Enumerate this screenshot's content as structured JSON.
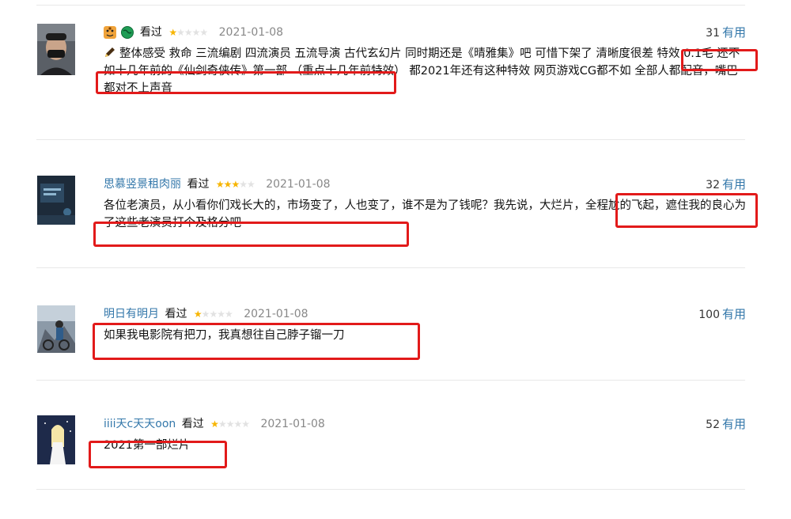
{
  "useful_label": "有用",
  "comments": [
    {
      "user": "",
      "status": "看过",
      "rating": 1,
      "date": "2021-01-08",
      "votes": "31",
      "icons": [
        "tiger-face-icon",
        "globe-icon"
      ],
      "body_icon": "pencil-icon",
      "text": "整体感受 救命 三流编剧 四流演员 五流导演 古代玄幻片 同时期还是《晴雅集》吧 可惜下架了 清晰度很差 特效 0.1毛 还不如十几年前的《仙剑奇侠传》第一部 （重点十几年前特效） 都2021年还有这种特效 网页游戏CG都不如 全部人都配音，嘴巴都对不上声音"
    },
    {
      "user": "思慕竖景租肉丽",
      "status": "看过",
      "rating": 3,
      "date": "2021-01-08",
      "votes": "32",
      "text": "各位老演员，从小看你们戏长大的，市场变了，人也变了，谁不是为了钱呢？我先说，大烂片，全程尬的飞起，遮住我的良心为了这些老演员打个及格分吧"
    },
    {
      "user": "明日有明月",
      "status": "看过",
      "rating": 1,
      "date": "2021-01-08",
      "votes": "100",
      "text": "如果我电影院有把刀，我真想往自己脖子镏一刀"
    },
    {
      "user": "iiii天c天天oon",
      "status": "看过",
      "rating": 1,
      "date": "2021-01-08",
      "votes": "52",
      "text": "2021第一部烂片"
    }
  ]
}
